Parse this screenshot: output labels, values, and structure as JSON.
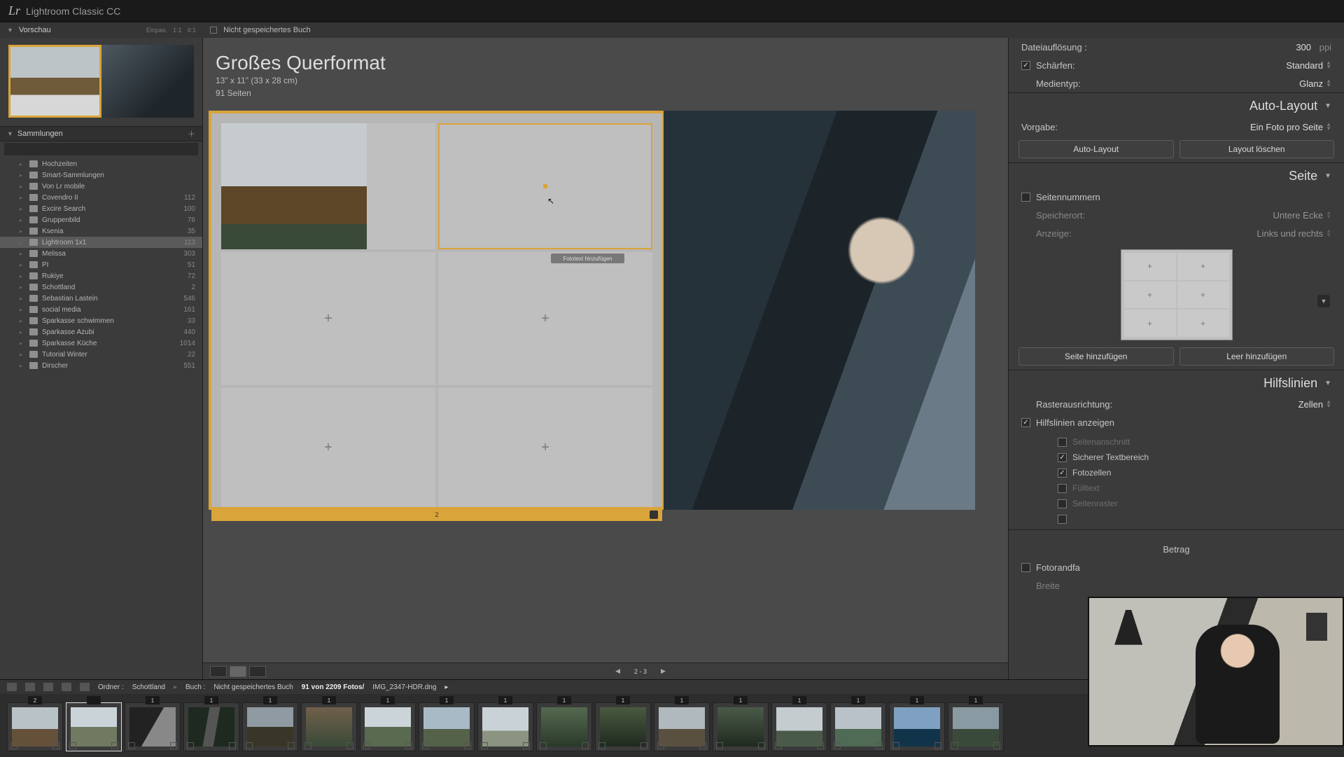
{
  "app": {
    "logo": "Lr",
    "name": "Lightroom Classic CC"
  },
  "subbar": {
    "preview_label": "Vorschau",
    "fit_labels": [
      "Einpas.",
      "1:1",
      "4:1"
    ],
    "book_status": "Nicht gespeichertes Buch"
  },
  "collections": {
    "title": "Sammlungen",
    "items": [
      {
        "name": "Hochzeiten",
        "count": "",
        "smart": false
      },
      {
        "name": "Smart-Sammlungen",
        "count": "",
        "smart": true
      },
      {
        "name": "Von Lr mobile",
        "count": "",
        "smart": false
      },
      {
        "name": "Covendro II",
        "count": "112",
        "smart": false
      },
      {
        "name": "Excire Search",
        "count": "100",
        "smart": false
      },
      {
        "name": "Gruppenbild",
        "count": "76",
        "smart": false
      },
      {
        "name": "Ksenia",
        "count": "35",
        "smart": false
      },
      {
        "name": "Lightroom 1x1",
        "count": "113",
        "smart": false,
        "selected": true
      },
      {
        "name": "Melissa",
        "count": "303",
        "smart": false
      },
      {
        "name": "PI",
        "count": "51",
        "smart": false
      },
      {
        "name": "Rukiye",
        "count": "72",
        "smart": false
      },
      {
        "name": "Schottland",
        "count": "2",
        "smart": false
      },
      {
        "name": "Sebastian Lastein",
        "count": "546",
        "smart": false
      },
      {
        "name": "social media",
        "count": "161",
        "smart": false
      },
      {
        "name": "Sparkasse schwimmen",
        "count": "33",
        "smart": false
      },
      {
        "name": "Sparkasse Azubi",
        "count": "440",
        "smart": false
      },
      {
        "name": "Sparkasse Küche",
        "count": "1014",
        "smart": false
      },
      {
        "name": "Tutorial Winter",
        "count": "22",
        "smart": false
      },
      {
        "name": "Dirscher",
        "count": "551",
        "smart": false
      }
    ]
  },
  "book": {
    "title": "Großes Querformat",
    "size_line": "13\" x 11\" (33 x 28 cm)",
    "pages_line": "91 Seiten",
    "caption_hint": "Fototext hinzufügen",
    "page_indicator_left": "2",
    "page_indicator_right": "3",
    "nav_range": "2 - 3"
  },
  "right": {
    "resolution_label": "Dateiauflösung :",
    "resolution_value": "300",
    "resolution_unit": "ppi",
    "sharpen_label": "Schärfen:",
    "sharpen_value": "Standard",
    "media_label": "Medientyp:",
    "media_value": "Glanz",
    "autolayout_title": "Auto-Layout",
    "preset_label": "Vorgabe:",
    "preset_value": "Ein Foto pro Seite",
    "btn_autolayout": "Auto-Layout",
    "btn_clearlayout": "Layout löschen",
    "page_title": "Seite",
    "pagenumbers_label": "Seitennummern",
    "location_label": "Speicherort:",
    "location_value": "Untere Ecke",
    "display_label": "Anzeige:",
    "display_value": "Links und rechts",
    "btn_addpage": "Seite hinzufügen",
    "btn_addblank": "Leer hinzufügen",
    "guides_title": "Hilfslinien",
    "gridalign_label": "Rasterausrichtung:",
    "gridalign_value": "Zellen",
    "showguides_label": "Hilfslinien anzeigen",
    "g_bleed": "Seitenanschnitt",
    "g_textsafe": "Sicherer Textbereich",
    "g_photocells": "Fotozellen",
    "g_filler": "Fülltext",
    "g_pagegrid": "Seitenraster",
    "photoborder_label": "Fotorandfa",
    "amount_label": "Betrag",
    "width_label": "Breite"
  },
  "filmstrip": {
    "folder_label": "Ordner :",
    "folder_name": "Schottland",
    "book_label": "Buch :",
    "book_name": "Nicht gespeichertes Buch",
    "count_text": "91 von 2209 Fotos/",
    "filename": "IMG_2347-HDR.dng",
    "thumbs": [
      {
        "badge": "2",
        "cls": "fi1",
        "sel": false
      },
      {
        "badge": "",
        "cls": "fi2",
        "sel": true
      },
      {
        "badge": "1",
        "cls": "fi3",
        "sel": false
      },
      {
        "badge": "1",
        "cls": "fi4",
        "sel": false
      },
      {
        "badge": "1",
        "cls": "fi5",
        "sel": false
      },
      {
        "badge": "1",
        "cls": "fi6",
        "sel": false
      },
      {
        "badge": "1",
        "cls": "fi7",
        "sel": false
      },
      {
        "badge": "1",
        "cls": "fi8",
        "sel": false
      },
      {
        "badge": "1",
        "cls": "fi9",
        "sel": false
      },
      {
        "badge": "1",
        "cls": "fi10",
        "sel": false
      },
      {
        "badge": "1",
        "cls": "fi11",
        "sel": false
      },
      {
        "badge": "1",
        "cls": "fi12",
        "sel": false
      },
      {
        "badge": "1",
        "cls": "fi13",
        "sel": false
      },
      {
        "badge": "1",
        "cls": "fi14",
        "sel": false
      },
      {
        "badge": "1",
        "cls": "fi15",
        "sel": false
      },
      {
        "badge": "1",
        "cls": "fi16",
        "sel": false
      },
      {
        "badge": "1",
        "cls": "fi17",
        "sel": false
      }
    ]
  }
}
